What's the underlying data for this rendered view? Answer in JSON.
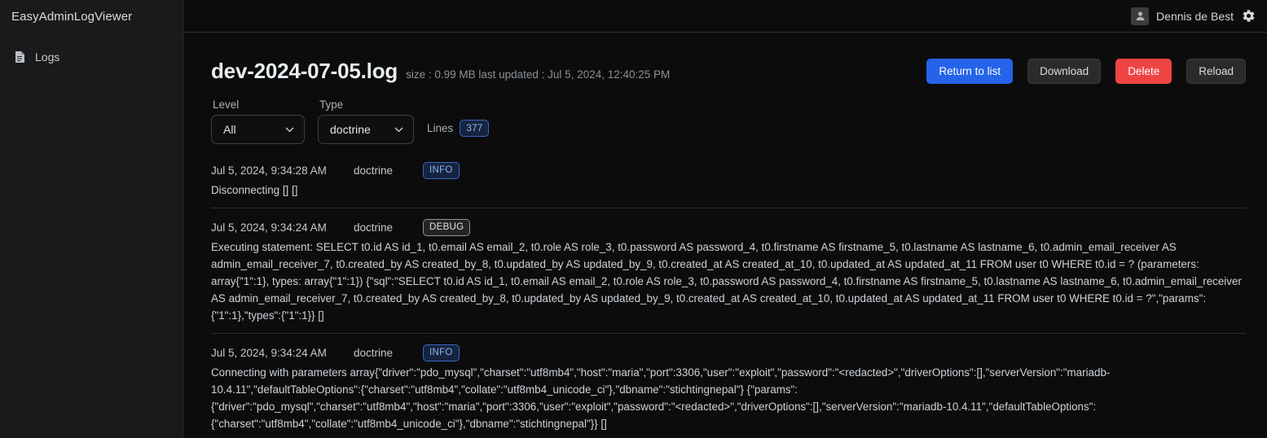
{
  "sidebar": {
    "brand": "EasyAdminLogViewer",
    "items": [
      {
        "label": "Logs",
        "icon": "document-icon"
      }
    ]
  },
  "topbar": {
    "username": "Dennis de Best",
    "avatar_icon": "user-avatar-icon",
    "settings_icon": "gear-icon"
  },
  "header": {
    "file_name": "dev-2024-07-05.log",
    "file_meta": "size : 0.99 MB last updated : Jul 5, 2024, 12:40:25 PM",
    "buttons": [
      {
        "label": "Return to list",
        "style": "primary"
      },
      {
        "label": "Download",
        "style": "secondary"
      },
      {
        "label": "Delete",
        "style": "danger"
      },
      {
        "label": "Reload",
        "style": "secondary"
      }
    ]
  },
  "filters": {
    "level": {
      "label": "Level",
      "value": "All"
    },
    "type": {
      "label": "Type",
      "value": "doctrine"
    },
    "lines": {
      "label": "Lines",
      "count": "377"
    }
  },
  "logs": [
    {
      "date": "Jul 5, 2024, 9:34:28 AM",
      "channel": "doctrine",
      "level": "INFO",
      "message": "Disconnecting [] []"
    },
    {
      "date": "Jul 5, 2024, 9:34:24 AM",
      "channel": "doctrine",
      "level": "DEBUG",
      "message": "Executing statement: SELECT t0.id AS id_1, t0.email AS email_2, t0.role AS role_3, t0.password AS password_4, t0.firstname AS firstname_5, t0.lastname AS lastname_6, t0.admin_email_receiver AS admin_email_receiver_7, t0.created_by AS created_by_8, t0.updated_by AS updated_by_9, t0.created_at AS created_at_10, t0.updated_at AS updated_at_11 FROM user t0 WHERE t0.id = ? (parameters: array{\"1\":1}, types: array{\"1\":1}) {\"sql\":\"SELECT t0.id AS id_1, t0.email AS email_2, t0.role AS role_3, t0.password AS password_4, t0.firstname AS firstname_5, t0.lastname AS lastname_6, t0.admin_email_receiver AS admin_email_receiver_7, t0.created_by AS created_by_8, t0.updated_by AS updated_by_9, t0.created_at AS created_at_10, t0.updated_at AS updated_at_11 FROM user t0 WHERE t0.id = ?\",\"params\":{\"1\":1},\"types\":{\"1\":1}} []"
    },
    {
      "date": "Jul 5, 2024, 9:34:24 AM",
      "channel": "doctrine",
      "level": "INFO",
      "message": "Connecting with parameters array{\"driver\":\"pdo_mysql\",\"charset\":\"utf8mb4\",\"host\":\"maria\",\"port\":3306,\"user\":\"exploit\",\"password\":\"<redacted>\",\"driverOptions\":[],\"serverVersion\":\"mariadb-10.4.11\",\"defaultTableOptions\":{\"charset\":\"utf8mb4\",\"collate\":\"utf8mb4_unicode_ci\"},\"dbname\":\"stichtingnepal\"} {\"params\":{\"driver\":\"pdo_mysql\",\"charset\":\"utf8mb4\",\"host\":\"maria\",\"port\":3306,\"user\":\"exploit\",\"password\":\"<redacted>\",\"driverOptions\":[],\"serverVersion\":\"mariadb-10.4.11\",\"defaultTableOptions\":{\"charset\":\"utf8mb4\",\"collate\":\"utf8mb4_unicode_ci\"},\"dbname\":\"stichtingnepal\"}} []"
    }
  ],
  "colors": {
    "accent_blue": "#2563eb",
    "danger_red": "#ef4444",
    "sidebar_bg": "#1a1a1a",
    "main_bg": "#0c0c0c",
    "badge_blue": "#93b4f0"
  }
}
